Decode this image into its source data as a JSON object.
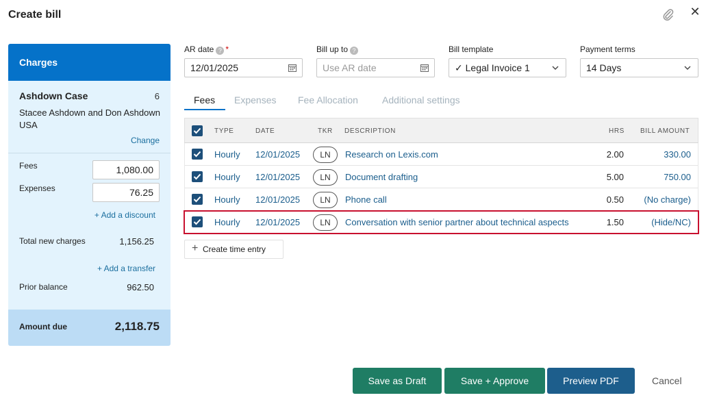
{
  "dialog": {
    "title": "Create bill"
  },
  "sidebar": {
    "header": "Charges",
    "case_name": "Ashdown Case",
    "case_count": "6",
    "client": "Stacee Ashdown and Don Ashdown",
    "country": "USA",
    "change_label": "Change",
    "fees_label": "Fees",
    "fees_value": "1,080.00",
    "expenses_label": "Expenses",
    "expenses_value": "76.25",
    "add_discount_label": "+ Add a discount",
    "total_new_charges_label": "Total new charges",
    "total_new_charges_value": "1,156.25",
    "add_transfer_label": "+ Add a transfer",
    "prior_balance_label": "Prior balance",
    "prior_balance_value": "962.50",
    "amount_due_label": "Amount due",
    "amount_due_value": "2,118.75"
  },
  "form": {
    "ar_date_label": "AR date",
    "ar_date_value": "12/01/2025",
    "bill_up_to_label": "Bill up to",
    "bill_up_to_placeholder": "Use AR date",
    "bill_template_label": "Bill template",
    "bill_template_value": "Legal Invoice 1",
    "payment_terms_label": "Payment terms",
    "payment_terms_value": "14 Days"
  },
  "tabs": [
    {
      "label": "Fees",
      "active": true
    },
    {
      "label": "Expenses",
      "active": false
    },
    {
      "label": "Fee Allocation",
      "active": false
    },
    {
      "label": "Additional settings",
      "active": false
    }
  ],
  "table": {
    "headers": {
      "type": "TYPE",
      "date": "DATE",
      "tkr": "TKR",
      "description": "DESCRIPTION",
      "hrs": "HRS",
      "bill_amount": "BILL AMOUNT"
    },
    "rows": [
      {
        "type": "Hourly",
        "date": "12/01/2025",
        "tkr": "LN",
        "description": "Research on Lexis.com",
        "hrs": "2.00",
        "amount": "330.00",
        "checked": true
      },
      {
        "type": "Hourly",
        "date": "12/01/2025",
        "tkr": "LN",
        "description": "Document drafting",
        "hrs": "5.00",
        "amount": "750.00",
        "checked": true
      },
      {
        "type": "Hourly",
        "date": "12/01/2025",
        "tkr": "LN",
        "description": "Phone call",
        "hrs": "0.50",
        "amount": "(No charge)",
        "checked": true
      },
      {
        "type": "Hourly",
        "date": "12/01/2025",
        "tkr": "LN",
        "description": "Conversation with senior partner about technical aspects",
        "hrs": "1.50",
        "amount": "(Hide/NC)",
        "checked": true
      }
    ]
  },
  "create_time_entry_label": "Create time entry",
  "footer": {
    "save_draft_label": "Save as Draft",
    "save_approve_label": "Save + Approve",
    "preview_pdf_label": "Preview PDF",
    "cancel_label": "Cancel"
  },
  "colors": {
    "primary_blue": "#0572c9",
    "green_button": "#1f7d64",
    "blue_button": "#1d5e8c",
    "highlight_red": "#c8102e",
    "sidebar_bg": "#e3f3fd"
  }
}
